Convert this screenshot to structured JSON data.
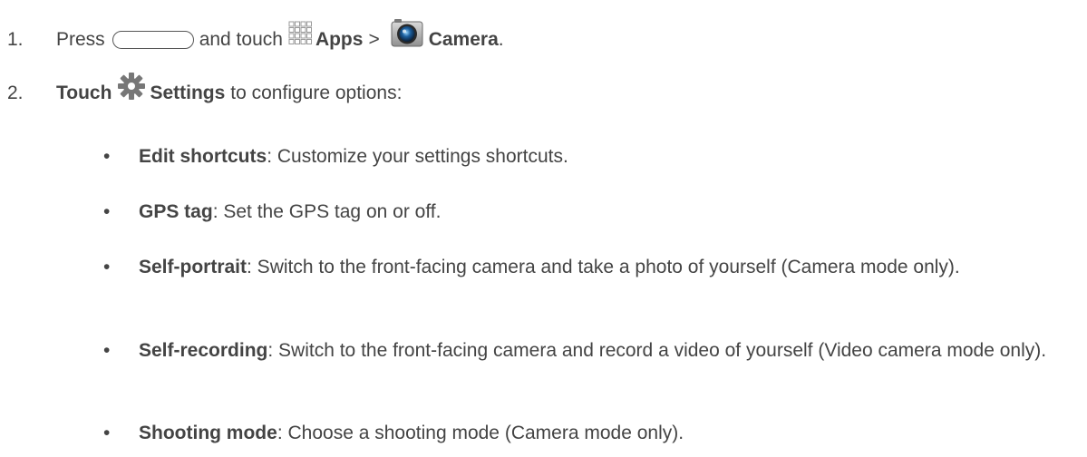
{
  "steps": [
    {
      "number": "1.",
      "press": "Press",
      "and_touch": "and touch",
      "apps_label": "Apps",
      "separator": ">",
      "camera_label": "Camera",
      "end": "."
    },
    {
      "number": "2.",
      "touch_label": "Touch",
      "settings_label": "Settings",
      "rest": "to configure options:"
    }
  ],
  "options": [
    {
      "term": "Edit shortcuts",
      "desc": ": Customize your settings shortcuts."
    },
    {
      "term": "GPS tag",
      "desc": ": Set the GPS tag on or off."
    },
    {
      "term": "Self-portrait",
      "desc": ": Switch to the front-facing camera and take a photo of yourself  (Camera mode only)."
    },
    {
      "term": "Self-recording",
      "desc": ": Switch to the front-facing camera and record a video of yourself  (Video camera mode only)."
    },
    {
      "term": "Shooting mode",
      "desc": ": Choose a shooting mode (Camera mode only)."
    }
  ],
  "bullet_symbol": "•",
  "colors": {
    "text": "#444444",
    "gear": "#777777",
    "apps_grid": "#9a9a9a"
  },
  "icons": [
    "home-button-icon",
    "apps-grid-icon",
    "camera-icon",
    "gear-icon"
  ]
}
